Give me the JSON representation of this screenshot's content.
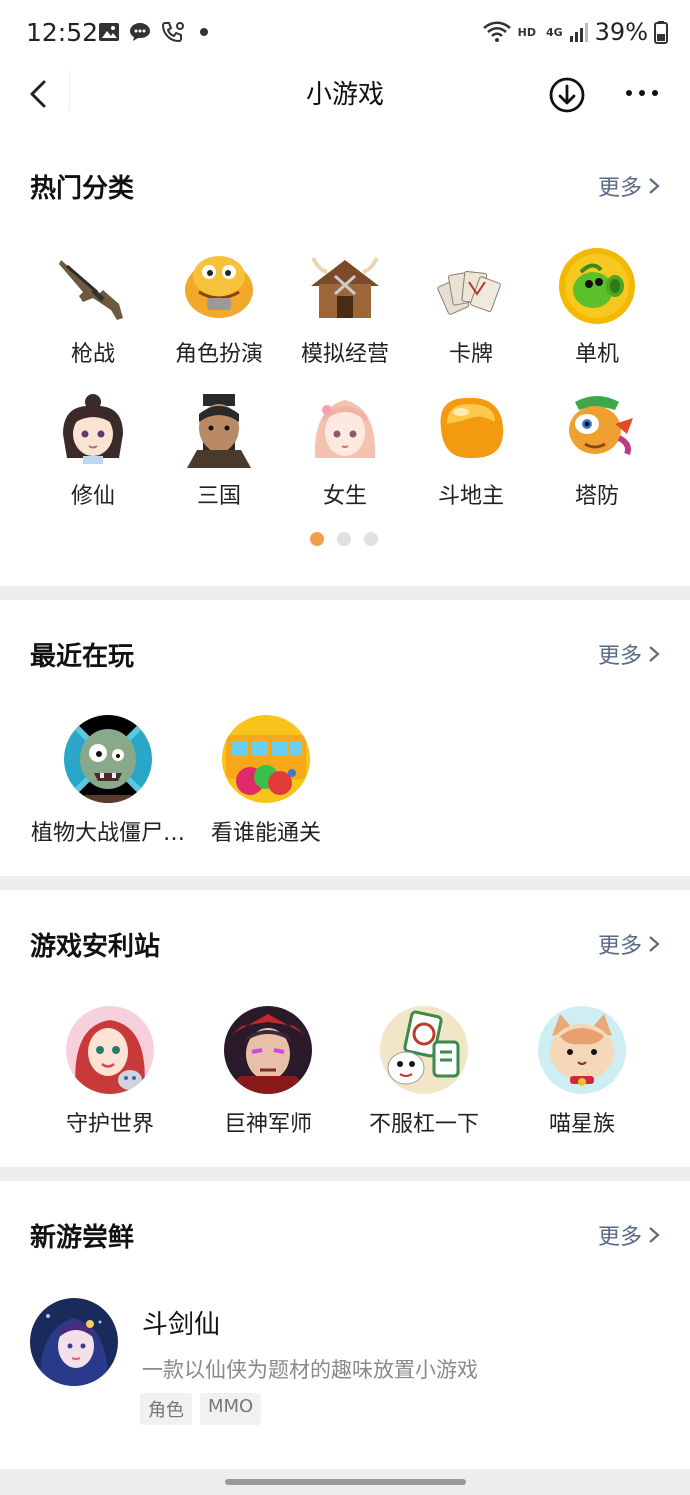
{
  "status_bar": {
    "time": "12:52",
    "battery": "39%",
    "network_hd": "HD",
    "network_4g": "4G"
  },
  "nav": {
    "title": "小游戏"
  },
  "hot_categories": {
    "heading": "热门分类",
    "more": "更多",
    "items": [
      {
        "label": "枪战",
        "icon": "rifle-icon"
      },
      {
        "label": "角色扮演",
        "icon": "cartoon-creature-icon"
      },
      {
        "label": "模拟经营",
        "icon": "hut-icon"
      },
      {
        "label": "卡牌",
        "icon": "cards-icon"
      },
      {
        "label": "单机",
        "icon": "peashooter-icon"
      },
      {
        "label": "修仙",
        "icon": "cultivator-girl-icon"
      },
      {
        "label": "三国",
        "icon": "three-kingdoms-general-icon"
      },
      {
        "label": "女生",
        "icon": "anime-girl-icon"
      },
      {
        "label": "斗地主",
        "icon": "orange-blob-icon"
      },
      {
        "label": "塔防",
        "icon": "bird-icon"
      }
    ],
    "page_dots": 3,
    "active_dot": 0
  },
  "recent": {
    "heading": "最近在玩",
    "more": "更多",
    "items": [
      {
        "label": "植物大战僵尸…",
        "icon": "zombie-avatar"
      },
      {
        "label": "看谁能通关",
        "icon": "bus-avatar"
      }
    ]
  },
  "recommend": {
    "heading": "游戏安利站",
    "more": "更多",
    "items": [
      {
        "label": "守护世界",
        "icon": "redhair-girl-avatar"
      },
      {
        "label": "巨神军师",
        "icon": "warrior-avatar"
      },
      {
        "label": "不服杠一下",
        "icon": "mahjong-avatar"
      },
      {
        "label": "喵星族",
        "icon": "cat-avatar"
      }
    ]
  },
  "new_games": {
    "heading": "新游尝鲜",
    "more": "更多",
    "item": {
      "title": "斗剑仙",
      "desc": "一款以仙侠为题材的趣味放置小游戏",
      "tags": [
        "角色",
        "MMO"
      ]
    }
  }
}
